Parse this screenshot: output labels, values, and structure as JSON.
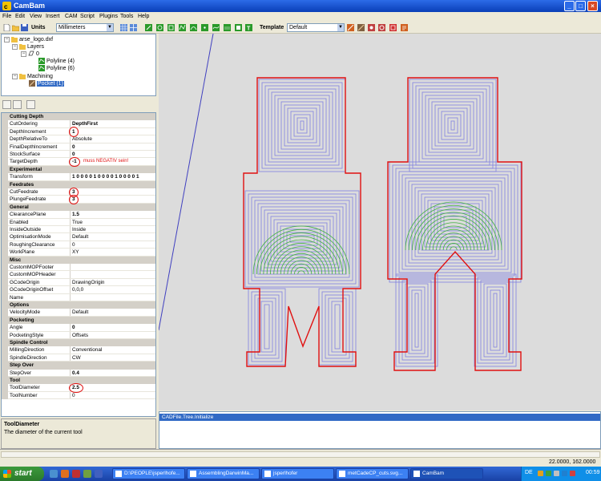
{
  "window": {
    "title": "CamBam"
  },
  "menu": [
    "File",
    "Edit",
    "View",
    "Insert",
    "CAM",
    "Script",
    "Plugins",
    "Tools",
    "Help"
  ],
  "toolbar": {
    "units_label": "Units",
    "units_value": "Millimeters",
    "template_label": "Template",
    "template_value": "Default"
  },
  "tree": {
    "file": "arse_logo.dxf",
    "layers": "Layers",
    "layer0": "0",
    "poly1": "Polyline (4)",
    "poly2": "Polyline (6)",
    "machining": "Machining",
    "pocket": "Pocket (1)"
  },
  "properties": [
    {
      "type": "cat",
      "k": "Cutting Depth"
    },
    {
      "k": "CutOrdering",
      "v": "DepthFirst",
      "bold": true
    },
    {
      "k": "DepthIncrement",
      "v": "1",
      "bold": true
    },
    {
      "k": "DepthRelativeTo",
      "v": "Absolute"
    },
    {
      "k": "FinalDepthIncrement",
      "v": "0",
      "bold": true
    },
    {
      "k": "StockSurface",
      "v": "0",
      "bold": true
    },
    {
      "k": "TargetDepth",
      "v": "-1",
      "bold": true
    },
    {
      "type": "cat",
      "k": "Experimental"
    },
    {
      "k": "Transform",
      "v": "1 0 0 0 0 1 0 0 0 0 1 0 0 0 0 1",
      "bold": true
    },
    {
      "type": "cat",
      "k": "Feedrates"
    },
    {
      "k": "CutFeedrate",
      "v": "3",
      "bold": true
    },
    {
      "k": "PlungeFeedrate",
      "v": "3",
      "bold": true
    },
    {
      "type": "cat",
      "k": "General"
    },
    {
      "k": "ClearancePlane",
      "v": "1.5",
      "bold": true
    },
    {
      "k": "Enabled",
      "v": "True"
    },
    {
      "k": "InsideOutside",
      "v": "Inside"
    },
    {
      "k": "OptimisationMode",
      "v": "Default"
    },
    {
      "k": "RoughingClearance",
      "v": "0"
    },
    {
      "k": "WorkPlane",
      "v": "XY"
    },
    {
      "type": "cat",
      "k": "Misc"
    },
    {
      "k": "CustomMOPFooter",
      "v": ""
    },
    {
      "k": "CustomMOPHeader",
      "v": ""
    },
    {
      "k": "GCodeOrigin",
      "v": "DrawingOrigin"
    },
    {
      "k": "GCodeOriginOffset",
      "v": "0,0,0"
    },
    {
      "k": "Name",
      "v": ""
    },
    {
      "type": "cat",
      "k": "Options"
    },
    {
      "k": "VelocityMode",
      "v": "Default"
    },
    {
      "type": "cat",
      "k": "Pocketing"
    },
    {
      "k": "Angle",
      "v": "0",
      "bold": true
    },
    {
      "k": "PocketingStyle",
      "v": "Offsets"
    },
    {
      "type": "cat",
      "k": "Spindle Control"
    },
    {
      "k": "MillingDirection",
      "v": "Conventional"
    },
    {
      "k": "SpindleDirection",
      "v": "CW"
    },
    {
      "type": "cat",
      "k": "Step Over"
    },
    {
      "k": "StepOver",
      "v": "0.4",
      "bold": true
    },
    {
      "type": "cat",
      "k": "Tool"
    },
    {
      "k": "ToolDiameter",
      "v": "2.5",
      "bold": true
    },
    {
      "k": "ToolNumber",
      "v": "0"
    }
  ],
  "annotation": "muss NEGATIV sein!",
  "help": {
    "title": "ToolDiameter",
    "desc": "The diameter of the current tool"
  },
  "log": {
    "line": "CADFile.Tree.Initialize"
  },
  "status": {
    "coords": "22.0000, 162.0000"
  },
  "taskbar": {
    "start": "start",
    "tasks": [
      "D:\\PEOPLE\\jsperlhofe...",
      "AssemblingDarwinMa...",
      "jsperlhofer",
      "metCadeCP_cuts.svg...",
      "CamBam"
    ],
    "lang": "DE",
    "clock": "00:59"
  },
  "colors": {
    "outline": "#e01010",
    "path_blue": "#8080e0",
    "path_green": "#40b040",
    "titlebar": "#0a3fb7"
  }
}
